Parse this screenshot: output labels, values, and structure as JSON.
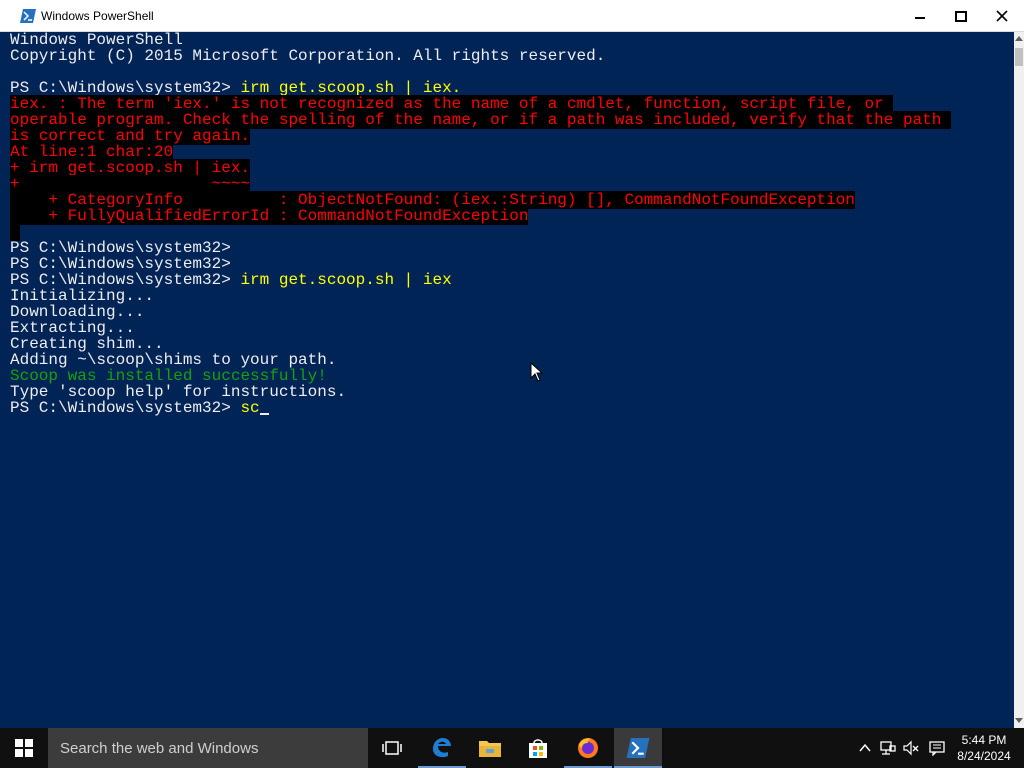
{
  "window": {
    "title": "Windows PowerShell",
    "buttons": {
      "minimize": "minimize",
      "maximize": "maximize",
      "close": "close"
    }
  },
  "console": {
    "lines": [
      {
        "text": "Windows PowerShell",
        "color": "white"
      },
      {
        "text": "Copyright (C) 2015 Microsoft Corporation. All rights reserved.",
        "color": "white"
      },
      {
        "text": "",
        "color": "white"
      },
      {
        "prompt": "PS C:\\Windows\\system32> ",
        "command": "irm get.scoop.sh | iex.",
        "color": "yellow"
      },
      {
        "text": "iex. : The term 'iex.' is not recognized as the name of a cmdlet, function, script file, or ",
        "color": "red",
        "error": true
      },
      {
        "text": "operable program. Check the spelling of the name, or if a path was included, verify that the path ",
        "color": "red",
        "error": true
      },
      {
        "text": "is correct and try again.",
        "color": "red",
        "error": true
      },
      {
        "text": "At line:1 char:20",
        "color": "red",
        "error": true
      },
      {
        "text": "+ irm get.scoop.sh | iex.",
        "color": "red",
        "error": true
      },
      {
        "text": "+                    ~~~~",
        "color": "red",
        "error": true
      },
      {
        "text": "    + CategoryInfo          : ObjectNotFound: (iex.:String) [], CommandNotFoundException",
        "color": "red",
        "error": true
      },
      {
        "text": "    + FullyQualifiedErrorId : CommandNotFoundException",
        "color": "red",
        "error": true
      },
      {
        "text": " ",
        "color": "red",
        "error": true
      },
      {
        "prompt": "PS C:\\Windows\\system32> ",
        "command": "",
        "color": "yellow"
      },
      {
        "prompt": "PS C:\\Windows\\system32> ",
        "command": "",
        "color": "yellow"
      },
      {
        "prompt": "PS C:\\Windows\\system32> ",
        "command": "irm get.scoop.sh | iex",
        "color": "yellow"
      },
      {
        "text": "Initializing...",
        "color": "white"
      },
      {
        "text": "Downloading...",
        "color": "white"
      },
      {
        "text": "Extracting...",
        "color": "white"
      },
      {
        "text": "Creating shim...",
        "color": "white"
      },
      {
        "text": "Adding ~\\scoop\\shims to your path.",
        "color": "white"
      },
      {
        "text": "Scoop was installed successfully!",
        "color": "green"
      },
      {
        "text": "Type 'scoop help' for instructions.",
        "color": "white"
      },
      {
        "prompt": "PS C:\\Windows\\system32> ",
        "command": "sc",
        "color": "yellow",
        "cursor": true
      }
    ]
  },
  "taskbar": {
    "search_placeholder": "Search the web and Windows",
    "apps": [
      {
        "name": "task-view",
        "icon": "task-view-icon"
      },
      {
        "name": "edge",
        "icon": "edge-icon"
      },
      {
        "name": "file-explorer",
        "icon": "folder-icon"
      },
      {
        "name": "store",
        "icon": "store-icon"
      },
      {
        "name": "firefox",
        "icon": "firefox-icon"
      },
      {
        "name": "powershell",
        "icon": "powershell-icon",
        "active": true
      }
    ],
    "tray": {
      "time": "5:44 PM",
      "date": "8/24/2024"
    }
  },
  "colors": {
    "console_bg": "#012456",
    "console_text": "#eeedf0",
    "command": "#ffff00",
    "error": "#ff0000",
    "success": "#13a10e",
    "taskbar": "#101010"
  }
}
